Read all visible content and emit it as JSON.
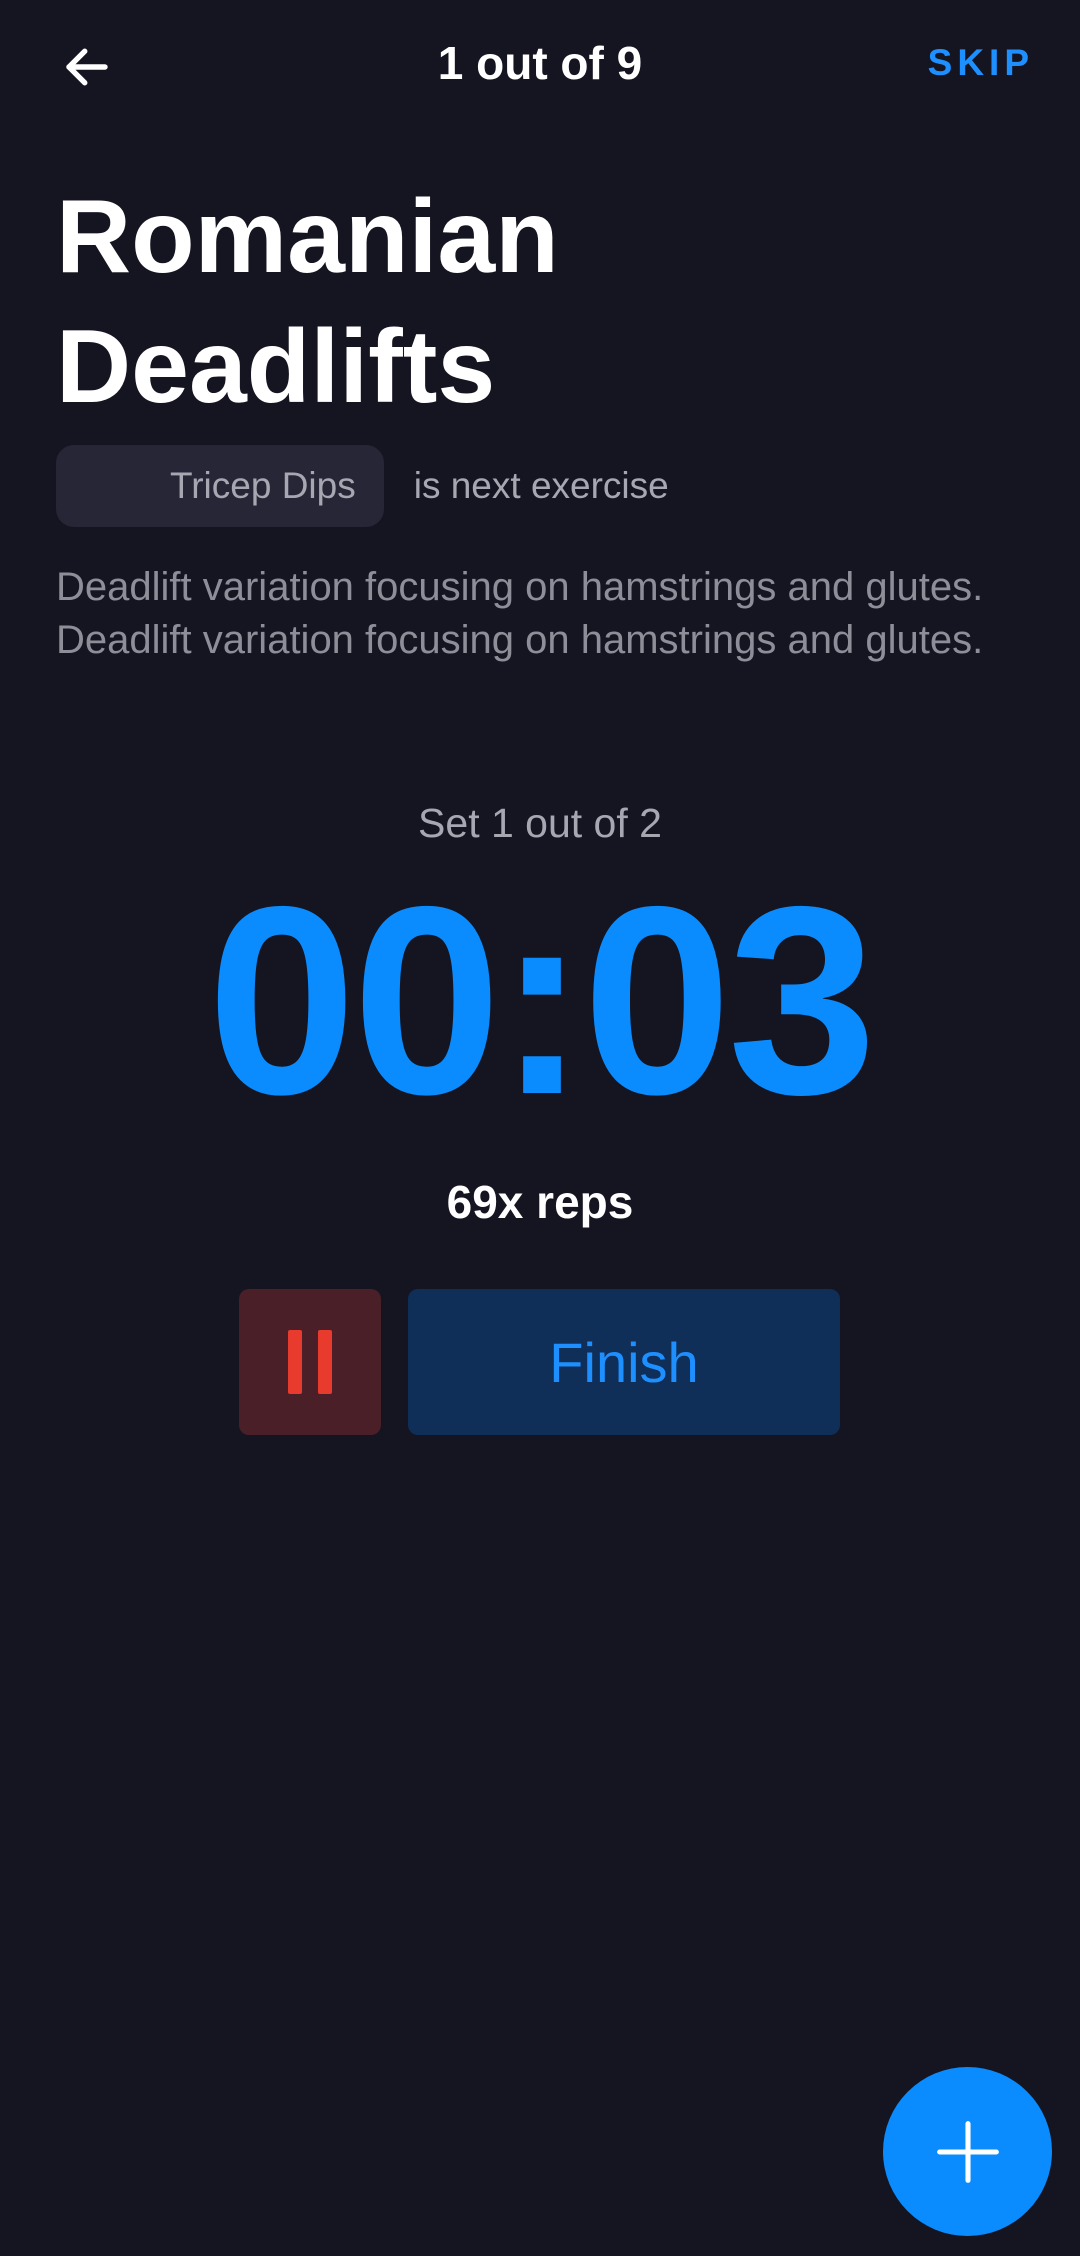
{
  "header": {
    "back_icon": "arrow-left-icon",
    "progress_title": "1 out of 9",
    "skip_label": "SKIP"
  },
  "exercise": {
    "name": "Romanian Deadlifts",
    "next_exercise_name": "Tricep Dips",
    "next_exercise_suffix": "is next exercise",
    "description": "Deadlift variation focusing on hamstrings and glutes. Deadlift variation focusing on hamstrings and glutes."
  },
  "workout": {
    "set_label": "Set 1 out of 2",
    "timer": "00:03",
    "reps_label": "69x reps"
  },
  "controls": {
    "pause_icon": "pause-icon",
    "finish_label": "Finish",
    "add_icon": "plus-icon"
  },
  "colors": {
    "background": "#151521",
    "accent": "#0a8cff",
    "pause_bg": "#4a1f28",
    "pause_fg": "#e83b2e",
    "finish_bg": "#0f2e58",
    "muted_text": "#a7a7b2"
  }
}
